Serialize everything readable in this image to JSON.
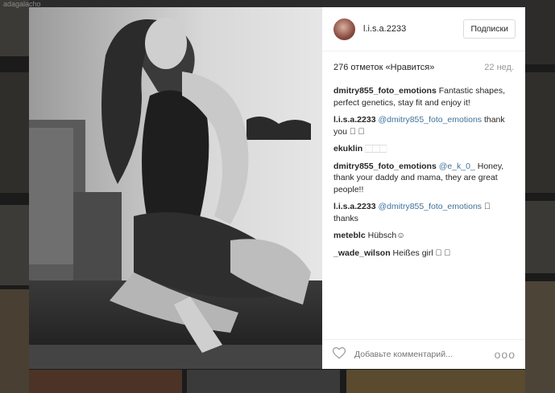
{
  "background": {
    "corner_text": "adagalacho"
  },
  "post": {
    "username": "l.i.s.a.2233",
    "follow_label": "Подписки",
    "likes": "276 отметок «Нравится»",
    "time": "22 нед.",
    "add_comment_placeholder": "Добавьте комментарий...",
    "more_label": "ooo",
    "comments": [
      {
        "user": "dmitry855_foto_emotions",
        "mention": "",
        "text": "Fantastic shapes, perfect genetics, stay fit and enjoy it!"
      },
      {
        "user": "l.i.s.a.2233",
        "mention": "@dmitry855_foto_emotions",
        "text": "thank you 🏻 🏻"
      },
      {
        "user": "ekuklin",
        "mention": "",
        "text": "🏻🏻🏻"
      },
      {
        "user": "dmitry855_foto_emotions",
        "mention": "@e_k_0_",
        "text": "Honey, thank your daddy and mama, they are great people!!"
      },
      {
        "user": "l.i.s.a.2233",
        "mention": "@dmitry855_foto_emotions",
        "text": "🏻 thanks"
      },
      {
        "user": "meteblc",
        "mention": "",
        "text": "Hübsch☺"
      },
      {
        "user": "_wade_wilson",
        "mention": "",
        "text": "Heißes girl 🏻 🏻"
      }
    ]
  },
  "colors": {
    "mention": "#3f729b",
    "text": "#262626",
    "muted": "#999999"
  }
}
